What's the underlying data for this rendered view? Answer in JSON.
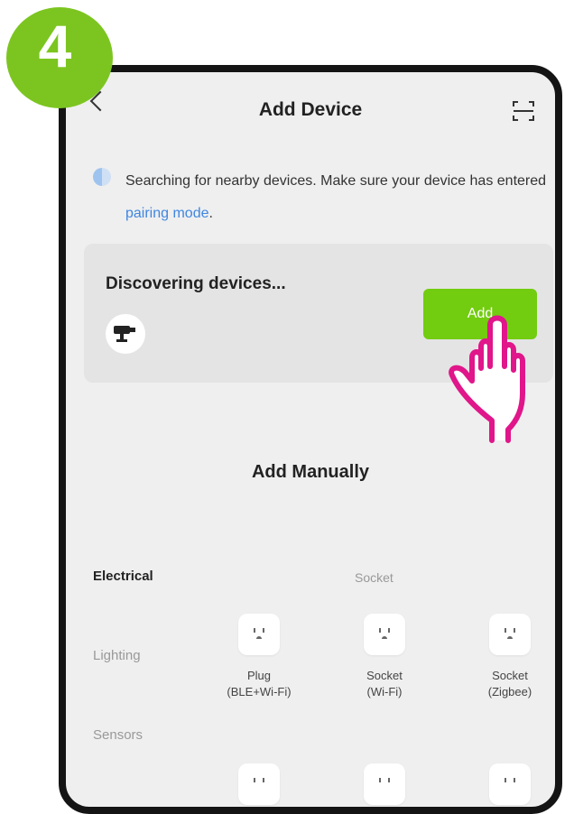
{
  "step_number": "4",
  "header": {
    "title": "Add Device"
  },
  "info": {
    "text": "Searching for nearby devices. Make sure your device has entered ",
    "link": "pairing mode",
    "suffix": "."
  },
  "discover": {
    "title": "Discovering devices...",
    "add_label": "Add"
  },
  "manual": {
    "title": "Add Manually",
    "categories": [
      "Electrical",
      "Lighting",
      "Sensors"
    ],
    "active_category": "Electrical",
    "group_title": "Socket",
    "devices": [
      {
        "line1": "Plug",
        "line2": "(BLE+Wi-Fi)"
      },
      {
        "line1": "Socket",
        "line2": "(Wi-Fi)"
      },
      {
        "line1": "Socket",
        "line2": "(Zigbee)"
      }
    ]
  },
  "colors": {
    "accent_green": "#72cc10",
    "badge_green": "#7cc520",
    "link_blue": "#3f86e0",
    "hand_pink": "#e0168a"
  },
  "icons": [
    "back-chevron-icon",
    "scan-icon",
    "camera-icon",
    "socket-icon",
    "pointing-hand-icon"
  ]
}
